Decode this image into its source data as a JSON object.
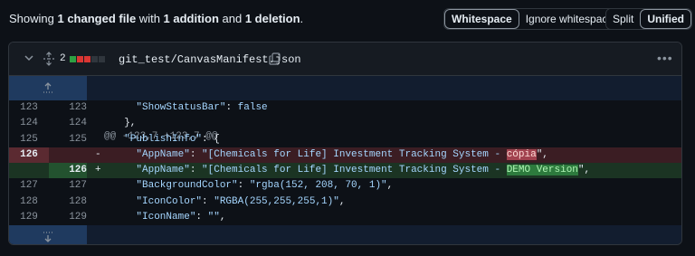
{
  "summary": {
    "prefix": "Showing ",
    "files": "1 changed file",
    "mid1": " with ",
    "additions": "1 addition",
    "mid2": " and ",
    "deletions": "1 deletion",
    "suffix": "."
  },
  "whitespace_toggle": {
    "whitespace": "Whitespace",
    "ignore": "Ignore whitespace"
  },
  "view_toggle": {
    "split": "Split",
    "unified": "Unified"
  },
  "file": {
    "change_count": "2",
    "name": "git_test/CanvasManifest.json",
    "diffstat": [
      "#2ea043",
      "#da3633",
      "#da3633",
      "#30363d",
      "#30363d"
    ]
  },
  "hunk_header": "@@ -123,7 +123,7 @@",
  "lines": [
    {
      "type": "ctx",
      "old": "123",
      "new": "123",
      "marker": "",
      "pre": "    ",
      "key": "\"ShowStatusBar\"",
      "sep": ": ",
      "val": "false",
      "post": ""
    },
    {
      "type": "ctx",
      "old": "124",
      "new": "124",
      "marker": "",
      "pre": "  },",
      "key": "",
      "sep": "",
      "val": "",
      "post": ""
    },
    {
      "type": "ctx",
      "old": "125",
      "new": "125",
      "marker": "",
      "pre": "  ",
      "key": "\"PublishInfo\"",
      "sep": ": {",
      "val": "",
      "post": ""
    },
    {
      "type": "del",
      "old": "126",
      "new": "",
      "marker": "-",
      "pre": "    ",
      "key": "\"AppName\"",
      "sep": ": ",
      "val": "\"[Chemicals for Life] Investment Tracking System - ",
      "hl": "cópia",
      "post": "\","
    },
    {
      "type": "add",
      "old": "",
      "new": "126",
      "marker": "+",
      "pre": "    ",
      "key": "\"AppName\"",
      "sep": ": ",
      "val": "\"[Chemicals for Life] Investment Tracking System - ",
      "hl": "DEMO Version",
      "post": "\","
    },
    {
      "type": "ctx",
      "old": "127",
      "new": "127",
      "marker": "",
      "pre": "    ",
      "key": "\"BackgroundColor\"",
      "sep": ": ",
      "val": "\"rgba(152, 208, 70, 1)\"",
      "post": ","
    },
    {
      "type": "ctx",
      "old": "128",
      "new": "128",
      "marker": "",
      "pre": "    ",
      "key": "\"IconColor\"",
      "sep": ": ",
      "val": "\"RGBA(255,255,255,1)\"",
      "post": ","
    },
    {
      "type": "ctx",
      "old": "129",
      "new": "129",
      "marker": "",
      "pre": "    ",
      "key": "\"IconName\"",
      "sep": ": ",
      "val": "\"\"",
      "post": ","
    }
  ],
  "icons": {
    "collapse": "chevron-down-icon",
    "expand_all": "unfold-icon",
    "copy": "copy-icon",
    "more": "kebab-horizontal-icon",
    "expand_up": "expand-up-icon",
    "expand_down": "expand-down-icon"
  },
  "colors": {
    "background": "#0d1117",
    "deletion": "#3b1d23",
    "addition": "#1b3423",
    "hunk": "#121d2f"
  }
}
